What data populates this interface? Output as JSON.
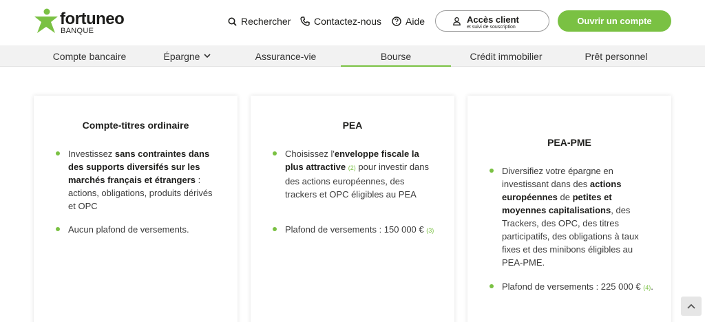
{
  "brand": {
    "name": "fortuneo",
    "sub": "BANQUE"
  },
  "header": {
    "search_label": "Rechercher",
    "contact_label": "Contactez-nous",
    "help_label": "Aide",
    "client_btn": {
      "line1": "Accès client",
      "line2": "et suivi de souscription"
    },
    "open_btn": "Ouvrir un compte"
  },
  "nav": {
    "items": [
      {
        "label": "Compte bancaire"
      },
      {
        "label": "Épargne"
      },
      {
        "label": "Assurance-vie"
      },
      {
        "label": "Bourse",
        "active": true
      },
      {
        "label": "Crédit immobilier"
      },
      {
        "label": "Prêt personnel"
      }
    ]
  },
  "cards": [
    {
      "title": "Compte-titres ordinaire",
      "b1": {
        "t1": "Investissez ",
        "s1": "sans contraintes dans des supports diversifés sur les marchés français et étrangers",
        "t2": " : actions, obligations, produits dérivés et OPC"
      },
      "b2": {
        "t1": "Aucun plafond de versements."
      }
    },
    {
      "title": "PEA",
      "b1": {
        "t1": "Choisissez l'",
        "s1": "enveloppe fiscale la plus attractive",
        "ref": "(2)",
        "t2": " pour investir dans des actions européennes, des trackers et OPC éligibles au PEA"
      },
      "b2": {
        "t1": "Plafond de versements : 150 000 €",
        "ref": "(3)"
      }
    },
    {
      "title": "PEA-PME",
      "b1": {
        "t1": "Diversifiez votre épargne en investissant dans des ",
        "s1": "actions européennes",
        "t2": " de ",
        "s2": "petites et moyennes capitalisations",
        "t3": ", des Trackers, des OPC, des titres participatifs, des obligations à taux fixes et des minibons éligibles au PEA-PME."
      },
      "b2": {
        "t1": "Plafond de versements : 225 000 €",
        "ref": "(4)",
        "t2": "."
      }
    }
  ],
  "colors": {
    "accent": "#7ac143",
    "nav_bg": "#f2f2f2"
  },
  "icons": [
    "search-icon",
    "phone-icon",
    "help-icon",
    "user-icon",
    "chevron-down-icon",
    "chevron-up-icon"
  ]
}
